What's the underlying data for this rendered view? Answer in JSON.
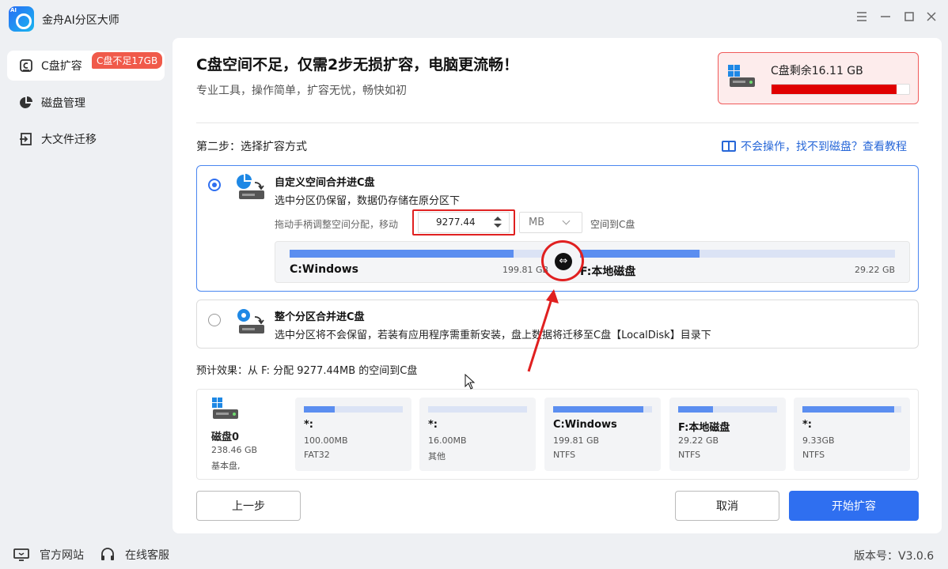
{
  "app": {
    "title": "金舟AI分区大师",
    "logo_text": "AI"
  },
  "window_controls": [
    "menu-icon",
    "minimize-icon",
    "maximize-icon",
    "close-icon"
  ],
  "sidebar": {
    "items": [
      {
        "label": "C盘扩容",
        "icon": "c-drive-icon",
        "active": true,
        "badge": "C盘不足17GB"
      },
      {
        "label": "磁盘管理",
        "icon": "pie-chart-icon"
      },
      {
        "label": "大文件迁移",
        "icon": "migrate-icon"
      }
    ]
  },
  "hero": {
    "title": "C盘空间不足，仅需2步无损扩容，电脑更流畅！",
    "subtitle": "专业工具，操作简单，扩容无忧，畅快如初"
  },
  "c_status": {
    "label": "C盘剩余16.11 GB",
    "used_fraction": 0.91,
    "bar_color": "#e00000"
  },
  "step": {
    "label": "第二步：选择扩容方式",
    "help_link": "不会操作，找不到磁盘？查看教程"
  },
  "option1": {
    "selected": true,
    "title": "自定义空间合并进C盘",
    "desc": "选中分区仍保留，数据仍存储在原分区下",
    "adjust_label": "拖动手柄调整空间分配，移动",
    "size_value": "9277.44",
    "unit": "MB",
    "suffix": "空间到C盘",
    "left_partition": {
      "name": "C:Windows",
      "size": "199.81 GB",
      "fill": 0.93
    },
    "right_partition": {
      "name": "F:本地磁盘",
      "size": "29.22 GB",
      "fill": 0.38
    }
  },
  "option2": {
    "selected": false,
    "title": "整个分区合并进C盘",
    "desc": "选中分区将不会保留，若装有应用程序需重新安装，盘上数据将迁移至C盘【LocalDisk】目录下"
  },
  "preview": {
    "label": "预计效果：从 F: 分配 9277.44MB 的空间到C盘",
    "disk": {
      "name": "磁盘0",
      "size": "238.46 GB",
      "type": "基本盘,"
    },
    "partitions": [
      {
        "name": "*:",
        "size": "100.00MB",
        "fs": "FAT32",
        "fill": 0.31
      },
      {
        "name": "*:",
        "size": "16.00MB",
        "fs": "其他",
        "fill": 0.0
      },
      {
        "name": "C:Windows",
        "size": "199.81 GB",
        "fs": "NTFS",
        "fill": 0.91
      },
      {
        "name": "F:本地磁盘",
        "size": "29.22 GB",
        "fs": "NTFS",
        "fill": 0.35
      },
      {
        "name": "*:",
        "size": "9.33GB",
        "fs": "NTFS",
        "fill": 0.93
      }
    ]
  },
  "buttons": {
    "back": "上一步",
    "cancel": "取消",
    "start": "开始扩容"
  },
  "footer": {
    "website": "官方网站",
    "support": "在线客服",
    "version": "版本号：V3.0.6"
  },
  "colors": {
    "accent": "#2f6ff0",
    "warning": "#f05a4a",
    "bar": "#5b8ef0"
  }
}
